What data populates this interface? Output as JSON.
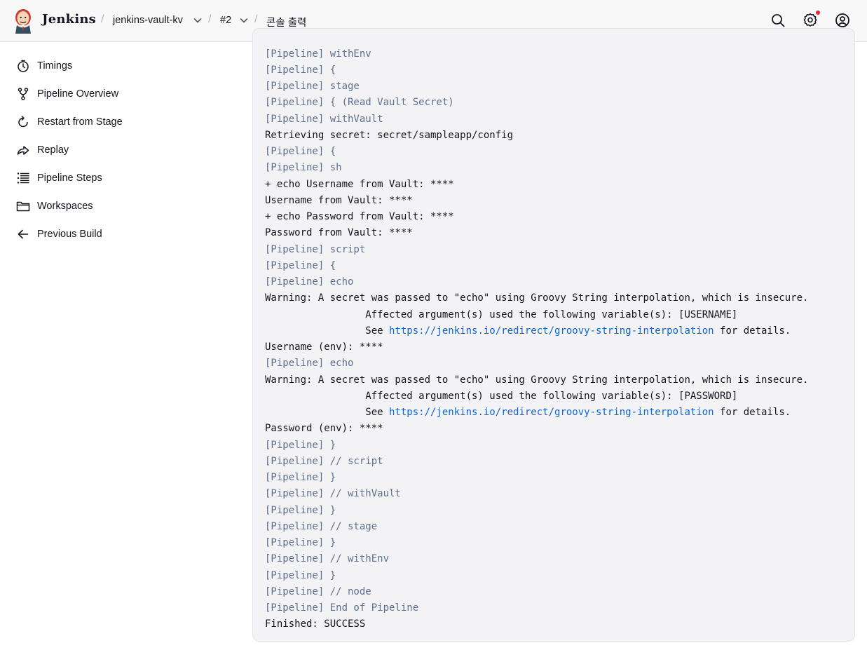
{
  "header": {
    "brand": "Jenkins",
    "breadcrumbs": [
      {
        "label": "jenkins-vault-kv",
        "has_dropdown": true
      },
      {
        "label": "#2",
        "has_dropdown": true
      },
      {
        "label": "콘솔 출력",
        "has_dropdown": false
      }
    ],
    "icons": [
      "search-icon",
      "settings-icon",
      "user-icon"
    ],
    "notification_color": "#e5253b"
  },
  "sidebar": {
    "items": [
      {
        "label": "Timings",
        "icon": "stopwatch-icon"
      },
      {
        "label": "Pipeline Overview",
        "icon": "branch-icon"
      },
      {
        "label": "Restart from Stage",
        "icon": "restart-icon"
      },
      {
        "label": "Replay",
        "icon": "replay-icon"
      },
      {
        "label": "Pipeline Steps",
        "icon": "steps-list-icon"
      },
      {
        "label": "Workspaces",
        "icon": "folder-icon"
      },
      {
        "label": "Previous Build",
        "icon": "arrow-left-icon"
      }
    ]
  },
  "console": {
    "colors": {
      "pipeline": "#5d708f",
      "output": "#14141f",
      "link": "#0f66d0"
    },
    "lines": [
      {
        "type": "pipeline",
        "parts": [
          {
            "text": "[Pipeline] withEnv"
          }
        ]
      },
      {
        "type": "pipeline",
        "parts": [
          {
            "text": "[Pipeline] {"
          }
        ]
      },
      {
        "type": "pipeline",
        "parts": [
          {
            "text": "[Pipeline] stage"
          }
        ]
      },
      {
        "type": "pipeline",
        "parts": [
          {
            "text": "[Pipeline] { (Read Vault Secret)"
          }
        ]
      },
      {
        "type": "pipeline",
        "parts": [
          {
            "text": "[Pipeline] withVault"
          }
        ]
      },
      {
        "type": "output",
        "parts": [
          {
            "text": "Retrieving secret: secret/sampleapp/config"
          }
        ]
      },
      {
        "type": "pipeline",
        "parts": [
          {
            "text": "[Pipeline] {"
          }
        ]
      },
      {
        "type": "pipeline",
        "parts": [
          {
            "text": "[Pipeline] sh"
          }
        ]
      },
      {
        "type": "output",
        "parts": [
          {
            "text": "+ echo Username from Vault: ****"
          }
        ]
      },
      {
        "type": "output",
        "parts": [
          {
            "text": "Username from Vault: ****"
          }
        ]
      },
      {
        "type": "output",
        "parts": [
          {
            "text": "+ echo Password from Vault: ****"
          }
        ]
      },
      {
        "type": "output",
        "parts": [
          {
            "text": "Password from Vault: ****"
          }
        ]
      },
      {
        "type": "pipeline",
        "parts": [
          {
            "text": "[Pipeline] script"
          }
        ]
      },
      {
        "type": "pipeline",
        "parts": [
          {
            "text": "[Pipeline] {"
          }
        ]
      },
      {
        "type": "pipeline",
        "parts": [
          {
            "text": "[Pipeline] echo"
          }
        ]
      },
      {
        "type": "output",
        "parts": [
          {
            "text": "Warning: A secret was passed to \"echo\" using Groovy String interpolation, which is insecure."
          }
        ]
      },
      {
        "type": "output",
        "parts": [
          {
            "text": "\t\t Affected argument(s) used the following variable(s): [USERNAME]"
          }
        ]
      },
      {
        "type": "output",
        "parts": [
          {
            "text": "\t\t See "
          },
          {
            "text": "https://jenkins.io/redirect/groovy-string-interpolation",
            "link": true
          },
          {
            "text": " for details."
          }
        ]
      },
      {
        "type": "output",
        "parts": [
          {
            "text": "Username (env): ****"
          }
        ]
      },
      {
        "type": "pipeline",
        "parts": [
          {
            "text": "[Pipeline] echo"
          }
        ]
      },
      {
        "type": "output",
        "parts": [
          {
            "text": "Warning: A secret was passed to \"echo\" using Groovy String interpolation, which is insecure."
          }
        ]
      },
      {
        "type": "output",
        "parts": [
          {
            "text": "\t\t Affected argument(s) used the following variable(s): [PASSWORD]"
          }
        ]
      },
      {
        "type": "output",
        "parts": [
          {
            "text": "\t\t See "
          },
          {
            "text": "https://jenkins.io/redirect/groovy-string-interpolation",
            "link": true
          },
          {
            "text": " for details."
          }
        ]
      },
      {
        "type": "output",
        "parts": [
          {
            "text": "Password (env): ****"
          }
        ]
      },
      {
        "type": "pipeline",
        "parts": [
          {
            "text": "[Pipeline] }"
          }
        ]
      },
      {
        "type": "pipeline",
        "parts": [
          {
            "text": "[Pipeline] // script"
          }
        ]
      },
      {
        "type": "pipeline",
        "parts": [
          {
            "text": "[Pipeline] }"
          }
        ]
      },
      {
        "type": "pipeline",
        "parts": [
          {
            "text": "[Pipeline] // withVault"
          }
        ]
      },
      {
        "type": "pipeline",
        "parts": [
          {
            "text": "[Pipeline] }"
          }
        ]
      },
      {
        "type": "pipeline",
        "parts": [
          {
            "text": "[Pipeline] // stage"
          }
        ]
      },
      {
        "type": "pipeline",
        "parts": [
          {
            "text": "[Pipeline] }"
          }
        ]
      },
      {
        "type": "pipeline",
        "parts": [
          {
            "text": "[Pipeline] // withEnv"
          }
        ]
      },
      {
        "type": "pipeline",
        "parts": [
          {
            "text": "[Pipeline] }"
          }
        ]
      },
      {
        "type": "pipeline",
        "parts": [
          {
            "text": "[Pipeline] // node"
          }
        ]
      },
      {
        "type": "pipeline",
        "parts": [
          {
            "text": "[Pipeline] End of Pipeline"
          }
        ]
      },
      {
        "type": "output",
        "parts": [
          {
            "text": "Finished: SUCCESS"
          }
        ]
      }
    ]
  }
}
